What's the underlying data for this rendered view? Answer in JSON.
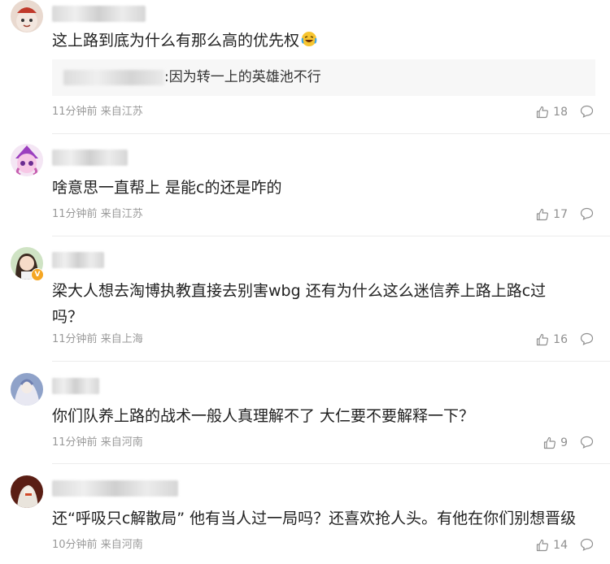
{
  "comments": [
    {
      "text": "这上路到底为什么有那么高的优先权",
      "reply": ":因为转一上的英雄池不行",
      "time": "11分钟前",
      "location": "来自江苏",
      "likes": "18"
    },
    {
      "text": "啥意思一直帮上 是能c的还是咋的",
      "time": "11分钟前",
      "location": "来自江苏",
      "likes": "17"
    },
    {
      "text_line1": "梁大人想去淘博执教直接去别害wbg 还有为什么这么迷信养上路上路c过",
      "text_line2": "吗？",
      "time": "11分钟前",
      "location": "来自上海",
      "likes": "16"
    },
    {
      "text": "你们队养上路的战术一般人真理解不了 大仁要不要解释一下？",
      "time": "11分钟前",
      "location": "来自河南",
      "likes": "9"
    },
    {
      "text": "还“呼吸只c解散局” 他有当人过一局吗？还喜欢抢人头。有他在你们别想晋级",
      "time": "10分钟前",
      "location": "来自河南",
      "likes": "14"
    }
  ],
  "icons": {
    "like": "thumbs-up-icon",
    "reply": "comment-bubble-icon",
    "emoji": "laughing-crying-emoji",
    "verified": "verified-badge-icon"
  },
  "colors": {
    "meta": "#9a9a9a",
    "text": "#222222",
    "reply_bg": "#f7f7f7",
    "badge": "#f5a623"
  }
}
